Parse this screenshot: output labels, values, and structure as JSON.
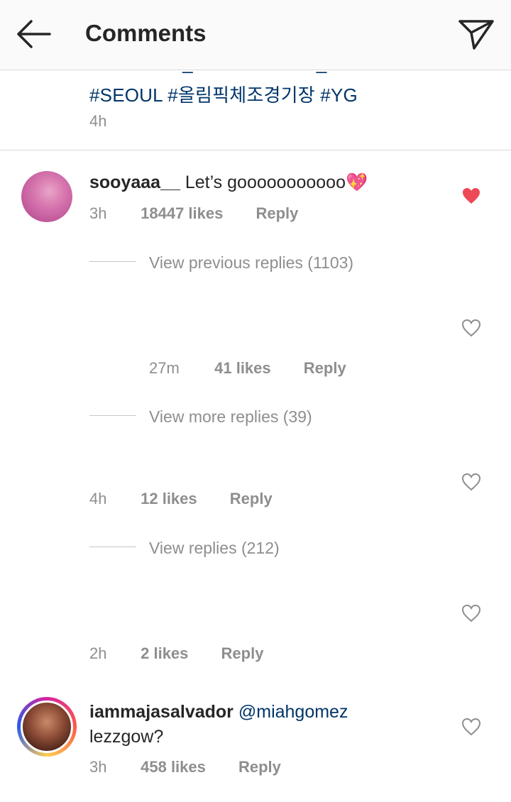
{
  "header": {
    "title": "Comments"
  },
  "caption": {
    "line1": "#OLYMPIC_GYMNASTICS_ARENA",
    "line2": "#SEOUL #올림픽체조경기장 #YG",
    "time": "4h"
  },
  "comments": [
    {
      "username": "sooyaaa__",
      "text": "Let’s gooooooooooo💖",
      "time": "3h",
      "likes": "18447 likes",
      "reply": "Reply",
      "liked": true,
      "view_replies": "View previous replies (1103)"
    },
    {
      "time": "27m",
      "likes": "41 likes",
      "reply": "Reply",
      "liked": false,
      "view_replies": "View more replies (39)"
    },
    {
      "time": "4h",
      "likes": "12 likes",
      "reply": "Reply",
      "liked": false,
      "view_replies": "View replies (212)"
    },
    {
      "time": "2h",
      "likes": "2 likes",
      "reply": "Reply",
      "liked": false
    },
    {
      "username": "iammajasalvador",
      "mention": "@miahgomez",
      "text": "lezzgow?",
      "time": "3h",
      "likes": "458 likes",
      "reply": "Reply",
      "liked": false
    }
  ],
  "colors": {
    "liked_heart": "#ed4956",
    "link": "#003569",
    "secondary_text": "#8e8e8e"
  },
  "icons": {
    "back": "arrow-left-icon",
    "send": "paper-plane-icon",
    "like": "heart-icon"
  }
}
